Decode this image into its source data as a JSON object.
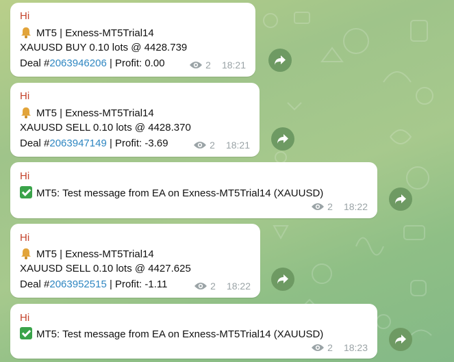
{
  "messages": [
    {
      "sender": "Hi",
      "icon": "bell-icon",
      "line1": "MT5 | Exness-MT5Trial14",
      "line2": "XAUUSD BUY  0.10 lots @ 4428.739",
      "deal_prefix": "Deal #",
      "deal_id": "2063946206",
      "deal_suffix": " | Profit: 0.00",
      "views": "2",
      "time": "18:21"
    },
    {
      "sender": "Hi",
      "icon": "bell-icon",
      "line1": "MT5 | Exness-MT5Trial14",
      "line2": "XAUUSD SELL  0.10 lots @ 4428.370",
      "deal_prefix": "Deal #",
      "deal_id": "2063947149",
      "deal_suffix": " | Profit: -3.69",
      "views": "2",
      "time": "18:21"
    },
    {
      "sender": "Hi",
      "icon": "check-icon",
      "line1": "MT5: Test message from EA on Exness-MT5Trial14 (XAUUSD)",
      "views": "2",
      "time": "18:22"
    },
    {
      "sender": "Hi",
      "icon": "bell-icon",
      "line1": "MT5 | Exness-MT5Trial14",
      "line2": "XAUUSD SELL  0.10 lots @ 4427.625",
      "deal_prefix": "Deal #",
      "deal_id": "2063952515",
      "deal_suffix": " | Profit: -1.11",
      "views": "2",
      "time": "18:22"
    },
    {
      "sender": "Hi",
      "icon": "check-icon",
      "line1": "MT5: Test message from EA on Exness-MT5Trial14 (XAUUSD)",
      "views": "2",
      "time": "18:23"
    }
  ],
  "colors": {
    "sender": "#c4432c",
    "link": "#2e86c1",
    "forward_button": "#6e9a63",
    "bubble": "#ffffff"
  }
}
